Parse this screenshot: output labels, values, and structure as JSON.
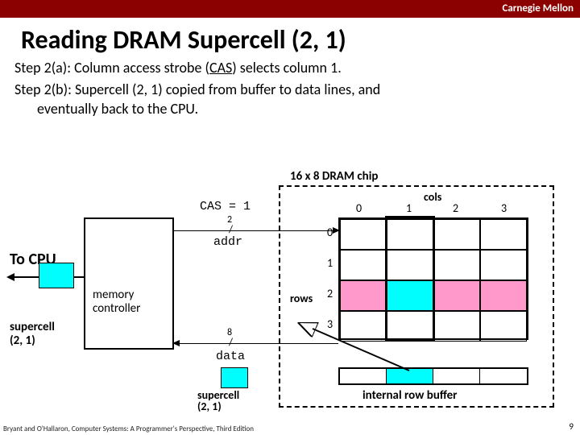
{
  "header": {
    "brand": "Carnegie Mellon"
  },
  "title": "Reading DRAM Supercell (2, 1)",
  "steps": {
    "a": "Step 2(a): Column access strobe (",
    "a_cas": "CAS",
    "a_tail": ") selects column 1.",
    "b_line1": "Step 2(b): Supercell (2, 1) copied from buffer to data lines, and",
    "b_line2": "eventually back to the CPU."
  },
  "diagram": {
    "chip_label": "16 x 8 DRAM chip",
    "cols_label": "cols",
    "rows_label": "rows",
    "col_numbers": [
      "0",
      "1",
      "2",
      "3"
    ],
    "row_numbers": [
      "0",
      "1",
      "2",
      "3"
    ],
    "internal_buffer": "internal row buffer",
    "to_cpu": "To CPU",
    "mem_ctrl": "memory\ncontroller",
    "cas_assign": "CAS = 1",
    "addr_width": "2",
    "addr_label": "addr",
    "data_width": "8",
    "data_label": "data",
    "supercell_data": "supercell\n(2, 1)",
    "supercell_left": "supercell\n(2, 1)"
  },
  "footer": "Bryant and O'Hallaron, Computer Systems: A Programmer's Perspective, Third Edition",
  "page": "9"
}
